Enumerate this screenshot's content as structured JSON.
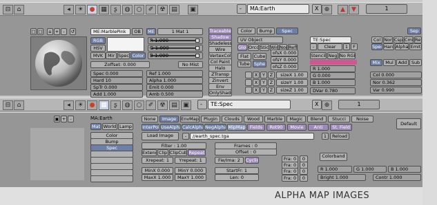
{
  "header1": {
    "window_icons": [
      "window-type-icon",
      "home-icon"
    ],
    "tool_icons": [
      "pointer-icon",
      "light-icon",
      "shading-icon",
      "material-icon",
      "object-icon",
      "world-icon",
      "radiosity-icon",
      "scene-icon",
      "script-icon",
      "render-icon"
    ],
    "browse_button": "-",
    "datablock_name": "MA:Earth",
    "close_button": "X",
    "users_count": "1"
  },
  "mat1": {
    "preview_tabs": [
      "icons"
    ],
    "material_name": "ME:MarblePink",
    "ob_button": "OB",
    "me_button": "ME",
    "mat_button": "1 Mat 1",
    "color_modes": [
      "RGB",
      "HSV",
      "MVK"
    ],
    "mir_label": "Mir",
    "spec_label": "Spec",
    "color_label": "Color",
    "rgb": [
      {
        "label": "R 1.000"
      },
      {
        "label": "G 1.000"
      },
      {
        "label": "B 1.000"
      }
    ],
    "zoffset": "Zoffset: 0.000",
    "no_mist": "No Mist",
    "left_params": [
      "Spec 0.000",
      "Hard 10",
      "SpTr 0.000",
      "Add 1.000"
    ],
    "right_params": [
      "Ref  1.000",
      "Alpha 1.000",
      "Emit  0.000",
      "Amb  0.500"
    ],
    "flag_buttons": [
      "Traceable",
      "Shadow",
      "Shadeless",
      "Wire",
      "VertexCol",
      "Col Paint",
      "Halo",
      "ZTransp",
      "Zinvert",
      "Env",
      "OnlyShadow"
    ]
  },
  "texpanel1": {
    "tabs": [
      "Color",
      "Bump",
      "Spec"
    ],
    "uv_object": "UV Object",
    "map_from": [
      "Glob",
      "Orco",
      "Stick",
      "Win",
      "Nor",
      "Refl"
    ],
    "projection": [
      "Flat",
      "Cube",
      "Tube",
      "Sphe"
    ],
    "axes": [
      "X",
      "Y",
      "Z"
    ],
    "ofs": [
      "ofsX 0.000",
      "ofsY 0.000",
      "ofsZ 0.000"
    ],
    "size": [
      "sizeX 1.00",
      "sizeY 1.00",
      "sizeZ 1.00"
    ],
    "tex_name": "TE:Spec",
    "clear_button": "Clear",
    "tex_users": "1",
    "stencil": [
      "Stencil",
      "Neg",
      "No RGB"
    ],
    "tex_rgb": [
      "R 1.000",
      "G 0.000",
      "B 1.000"
    ],
    "dvar": "DVar 0.780",
    "map_to": [
      "Col",
      "Nor",
      "Csp",
      "Cmir",
      "Ref",
      "Spec",
      "Hard",
      "Alpha",
      "Emit"
    ],
    "sep_label": "Sep",
    "blend_modes": [
      "Mix",
      "Mul",
      "Add",
      "Sub"
    ],
    "col_params": [
      "Col 0.000",
      "Nor 0.362",
      "Var 0.990"
    ]
  },
  "header2": {
    "datablock_name": "TE:Spec",
    "close_button": "X",
    "users_count": "1"
  },
  "tex2": {
    "top_label": "MA:Earth",
    "sources": [
      "Mat",
      "World",
      "Lamp"
    ],
    "channels": [
      "Color",
      "Bump",
      "Spec"
    ],
    "types_row1": [
      "None",
      "Image",
      "EnvMap",
      "Plugin",
      "Clouds",
      "Wood",
      "Marble",
      "Magic",
      "Blend",
      "Stucci",
      "Noise"
    ],
    "types_row2": [
      "InterPol",
      "UseAlpha",
      "CalcAlpha",
      "NegAlpha",
      "MipMap",
      "Fields",
      "Rot90",
      "Movie",
      "Anti",
      "St. Field"
    ],
    "default_vars": "Default Vars",
    "load_image": "Load Image",
    "image_path": "//earth_spec.tga",
    "reload_users": "1",
    "reload": "Reload",
    "filter": "Filter : 1.00",
    "frames": "Frames : 0",
    "offset": "Offset : 0",
    "extend_modes": [
      "Extend",
      "Clip",
      "ClipCube",
      "Repeat"
    ],
    "xrepeat": "Xrepeat: 1",
    "yrepeat": "Yrepeat: 1",
    "fie_img": "Fie/Ima: 2",
    "cyclic": "Cyclic",
    "colorband": "Colorband",
    "minx": "MinX 0.000",
    "miny": "MinY 0.000",
    "maxx": "MaxX 1.000",
    "maxy": "MaxY 1.000",
    "startfr": "StartFr: 1",
    "len": "Len: 0",
    "fra_values": [
      "Fra: 0",
      "Fra: 0",
      "Fra: 0",
      "Fra: 0"
    ],
    "fra_right": [
      "0",
      "0",
      "0",
      "0"
    ],
    "tex_rgb": [
      "R 1.000",
      "G 1.000",
      "B 1.000"
    ],
    "bright": "Bright 1.000",
    "contr": "Contr 1.000"
  },
  "caption": "ALPHA MAP IMAGES",
  "colors": {
    "selected": "#6d7fa6",
    "purple": "#9d8ab8",
    "pink": "#d05892",
    "red_icon": "#c8402a"
  }
}
